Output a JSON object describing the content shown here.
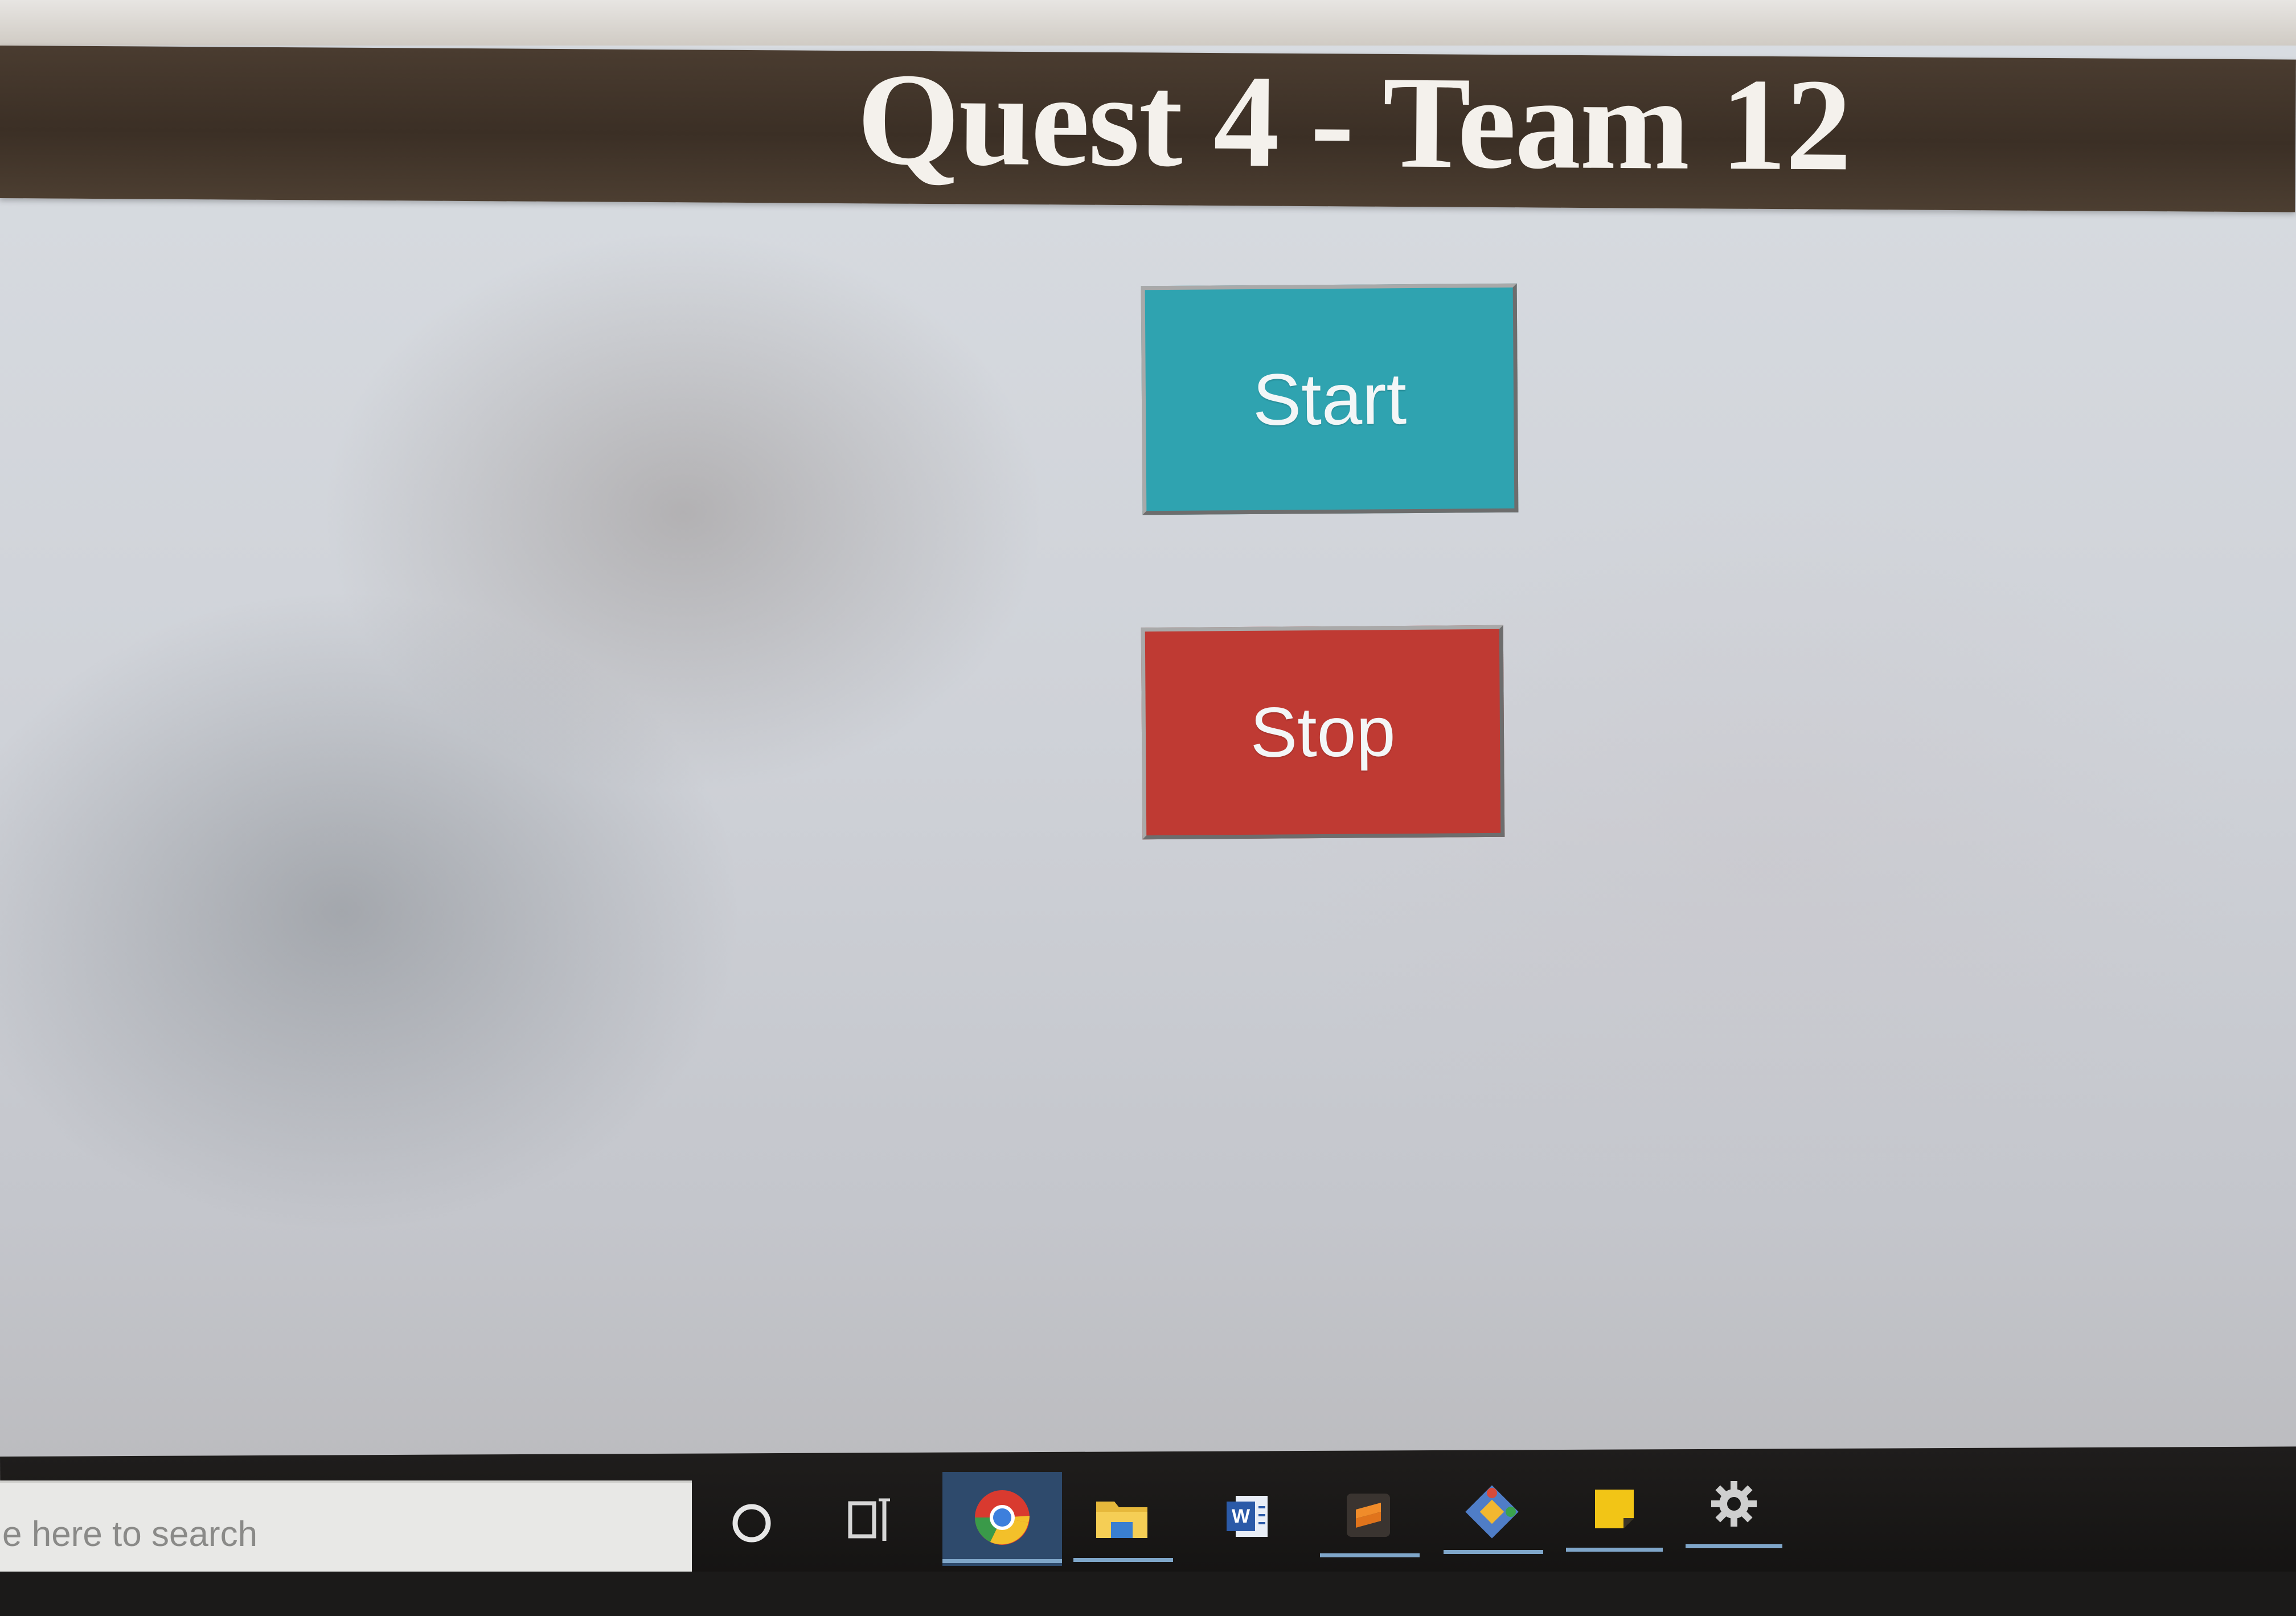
{
  "header": {
    "title": "Quest 4 - Team 12",
    "background_color": "#3e3228",
    "text_color": "#f4f1ec"
  },
  "controls": {
    "start_label": "Start",
    "start_color": "#2fa3b0",
    "stop_label": "Stop",
    "stop_color": "#bf3a33"
  },
  "taskbar": {
    "search_placeholder": "e here to search",
    "icons": [
      "cortana-icon",
      "task-view-icon",
      "chrome-icon",
      "file-explorer-icon",
      "word-icon",
      "sublime-text-icon",
      "git-app-icon",
      "sticky-notes-icon",
      "settings-icon"
    ]
  }
}
